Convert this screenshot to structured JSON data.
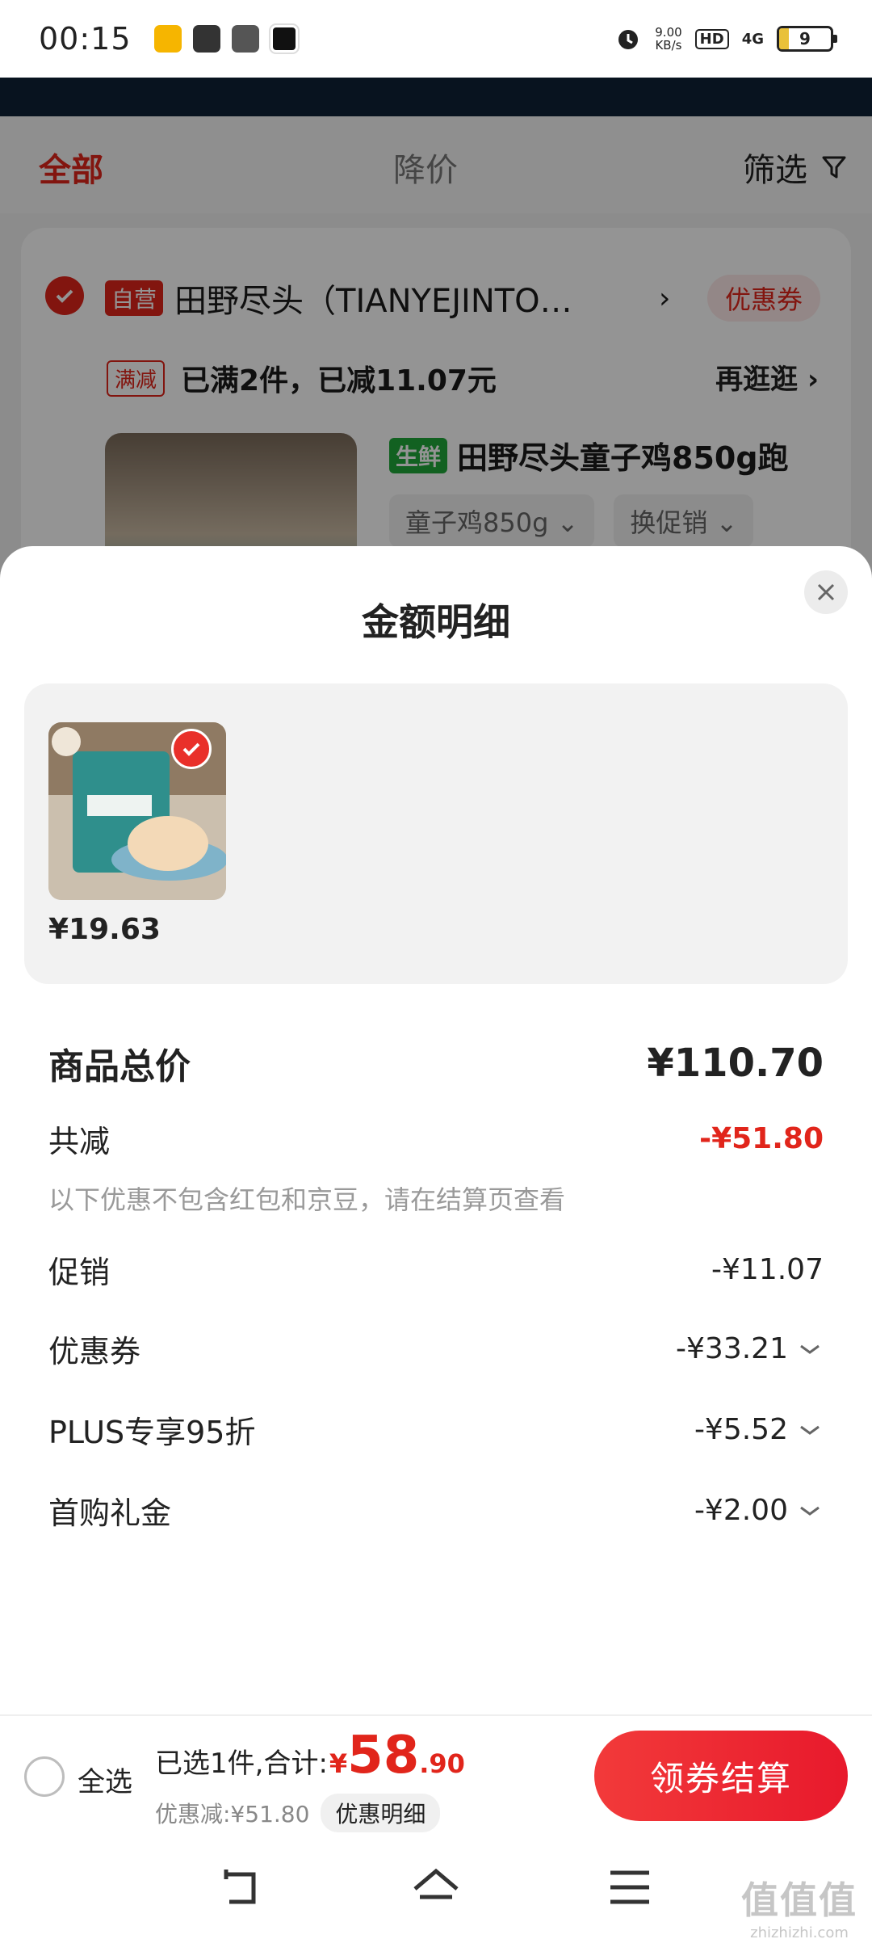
{
  "status_bar": {
    "time": "00:15",
    "net_speed_value": "9.00",
    "net_speed_unit": "KB/s",
    "hd": "HD",
    "signal": "4G",
    "battery": "9"
  },
  "filter_tabs": {
    "all": "全部",
    "price_drop": "降价",
    "filter": "筛选"
  },
  "shop": {
    "self_badge": "自营",
    "name": "田野尽头（TIANYEJINTO…",
    "coupon": "优惠券",
    "promo_badge": "满减",
    "promo_text": "已满2件，已减11.07元",
    "more_link": "再逛逛 ›",
    "product_badge": "生鲜",
    "product_title": "田野尽头童子鸡850g跑",
    "option_spec": "童子鸡850g",
    "option_promo": "换促销"
  },
  "sheet": {
    "title": "金额明细",
    "item_price": "¥19.63",
    "total_label": "商品总价",
    "total_value": "¥110.70",
    "saving_label": "共减",
    "saving_value": "-¥51.80",
    "note": "以下优惠不包含红包和京豆，请在结算页查看",
    "lines": [
      {
        "label": "促销",
        "value": "-¥11.07"
      },
      {
        "label": "优惠券",
        "value": "-¥33.21"
      },
      {
        "label": "PLUS专享95折",
        "value": "-¥5.52"
      },
      {
        "label": "首购礼金",
        "value": "-¥2.00"
      }
    ]
  },
  "action_bar": {
    "select_all": "全选",
    "summary_prefix": "已选1件,合计:",
    "currency": "¥",
    "total_int": "58",
    "total_dec": ".90",
    "discount_text": "优惠减:¥51.80",
    "detail_pill": "优惠明细",
    "checkout": "领券结算"
  },
  "watermark": {
    "main": "值值值",
    "domain": "zhizhizhi.com"
  },
  "colors": {
    "accent_red": "#e1251b",
    "fresh_green": "#1fa83a"
  }
}
